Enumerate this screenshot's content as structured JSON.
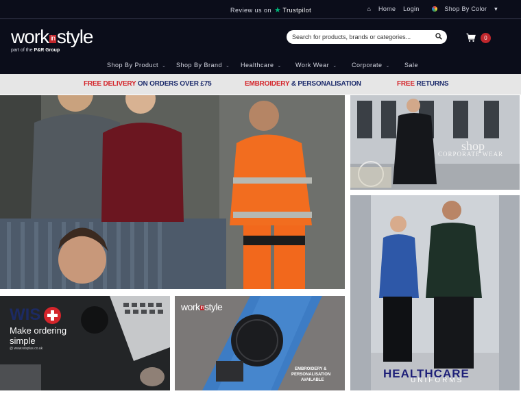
{
  "topbar": {
    "review_prefix": "Review us on",
    "review_brand": "Trustpilot",
    "home_label": "Home",
    "login_label": "Login",
    "color_label": "Shop By Color"
  },
  "header": {
    "logo_word_left": "work",
    "logo_word_in": "in",
    "logo_word_right": "style",
    "logo_sub_prefix": "part of the",
    "logo_sub_group": "P&R Group",
    "search_placeholder": "Search for products, brands or categories...",
    "cart_count": "0"
  },
  "nav": {
    "items": [
      {
        "label": "Shop By Product"
      },
      {
        "label": "Shop By Brand"
      },
      {
        "label": "Healthcare"
      },
      {
        "label": "Work Wear"
      },
      {
        "label": "Corporate"
      },
      {
        "label": "Sale"
      }
    ]
  },
  "promo": {
    "delivery_a": "FREE DELIVERY",
    "delivery_b": "ON ORDERS OVER £75",
    "emb_a": "EMBROIDERY",
    "emb_b": "& PERSONALISATION",
    "ret_a": "FREE",
    "ret_b": "RETURNS"
  },
  "tiles": {
    "corporate_title": "shop",
    "corporate_sub": "CORPORATE WEAR",
    "health_title": "HEALTHCARE",
    "health_sub": "UNIFORMS",
    "order_brand": "WIS",
    "order_line1": "Make ordering",
    "order_line2": "simple",
    "order_url": "www.wisplus.co.uk",
    "emb_logo_left": "work",
    "emb_logo_in": "in",
    "emb_logo_right": "style",
    "emb_line1": "EMBROIDERY &",
    "emb_line2": "PERSONALISATION",
    "emb_line3": "AVAILABLE"
  },
  "colors": {
    "header_bg": "#0b0d1a",
    "accent_red": "#d4252b",
    "navy": "#1b2a6b",
    "trustpilot_green": "#00b67a"
  }
}
